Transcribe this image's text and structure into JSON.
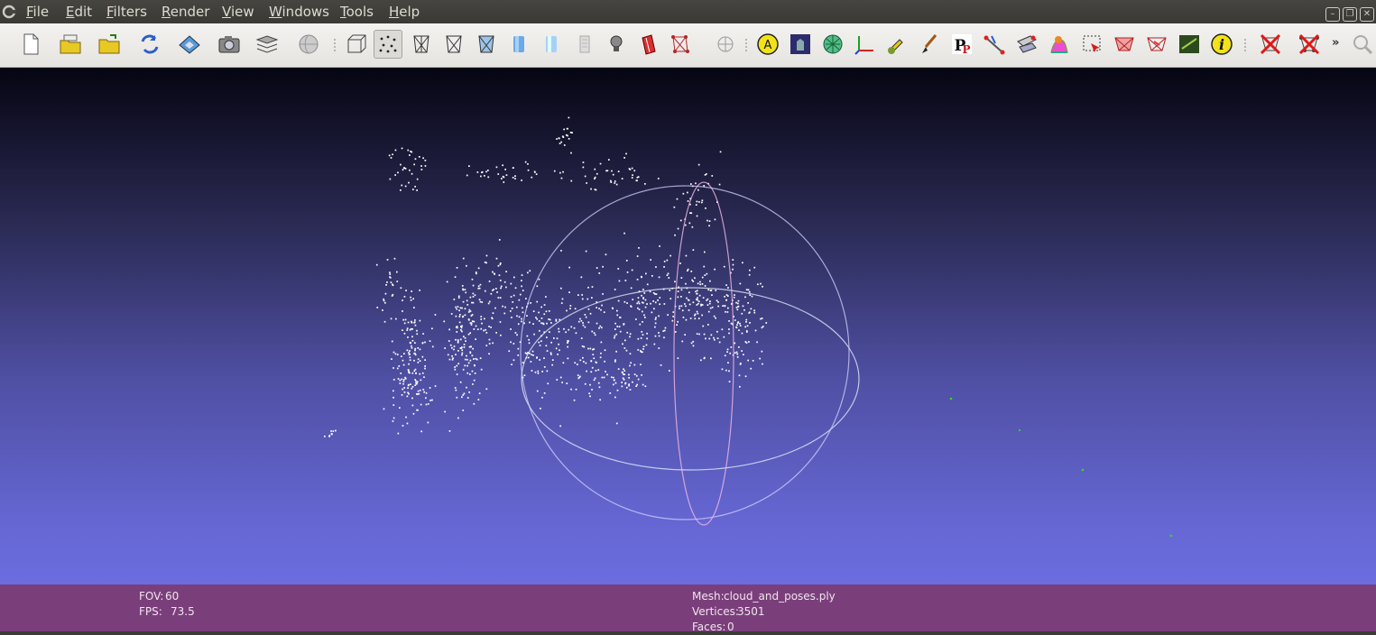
{
  "menubar": {
    "items": [
      "File",
      "Edit",
      "Filters",
      "Render",
      "View",
      "Windows",
      "Tools",
      "Help"
    ],
    "window_controls": [
      "minimize",
      "restore",
      "close"
    ]
  },
  "toolbar": {
    "buttons": [
      "new-file-icon",
      "open-project-icon",
      "open-mesh-icon",
      "reload-icon",
      "save-icon",
      "snapshot-icon",
      "layers-icon",
      "bounding-box-icon",
      "points-render-icon",
      "wireframe-icon",
      "flat-lines-icon",
      "flat-icon",
      "smooth-icon",
      "texture-icon",
      "light-bulb-icon",
      "color-mode-icon",
      "trackball-icon",
      "annotation-icon",
      "ambient-occlusion-icon",
      "render-options-icon",
      "axis-icon",
      "paint-icon",
      "brush-icon",
      "point-picker-icon",
      "measure-icon",
      "align-icon",
      "raster-icon",
      "select-faces-icon",
      "select-vertices-icon",
      "select-connected-icon",
      "edit-quality-icon",
      "info-icon",
      "delete-faces-icon",
      "delete-vertices-icon",
      "zoom-icon"
    ],
    "overflow": "»"
  },
  "colors": {
    "statusbar": "#7a3f7b",
    "points": "#ffffff",
    "camera_poses": "#24e024"
  },
  "status": {
    "fov_label": "FOV:",
    "fov_value": "60",
    "fps_label": "FPS:",
    "fps_value": "73.5",
    "mesh_label": "Mesh:",
    "mesh_value": "cloud_and_poses.ply",
    "vertices_label": "Vertices:",
    "vertices_value": "3501",
    "faces_label": "Faces:",
    "faces_value": "0"
  }
}
